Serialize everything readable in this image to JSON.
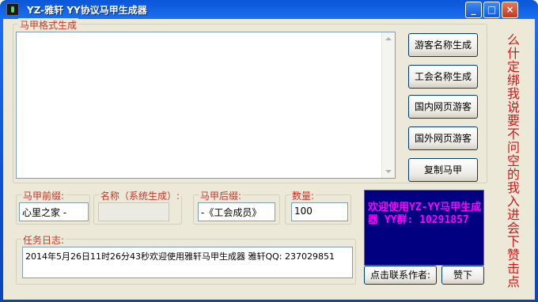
{
  "window": {
    "title": "YZ-雅轩   YY协议马甲生成器",
    "min_label": "_",
    "max_label": "□",
    "close_label": "×"
  },
  "format_group": {
    "legend": "马甲格式生成",
    "output_text": ""
  },
  "buttons": {
    "guest_name": "游客名称生成",
    "guild_name": "工会名称生成",
    "domestic_web_guest": "国内网页游客",
    "foreign_web_guest": "国外网页游客",
    "copy": "复制马甲"
  },
  "fields": {
    "prefix_label": "马甲前缀:",
    "prefix_value": "心里之家    -",
    "name_label": "名称（系统生成）:",
    "name_value": "",
    "suffix_label": "马甲后缀:",
    "suffix_value": "-《工会成员》",
    "count_label": "数量:",
    "count_value": "100"
  },
  "log": {
    "legend": "任务日志:",
    "line": "2014年5月26日11时26分43秒欢迎使用雅轩马甲生成器 雅轩QQ: 237029851"
  },
  "promo": {
    "text": "欢迎使用YZ-YY马甲生成器 YY群: 10291857",
    "contact_button": "点击联系作者:",
    "like_button": "赞下"
  },
  "vertical_text": "么什定绑我说要不问空的我入进会下赞击点",
  "colors": {
    "panel_bg": "#000080",
    "panel_text": "#ff00ff",
    "legend_text": "#c0392b",
    "vertical_text": "#d01818"
  }
}
